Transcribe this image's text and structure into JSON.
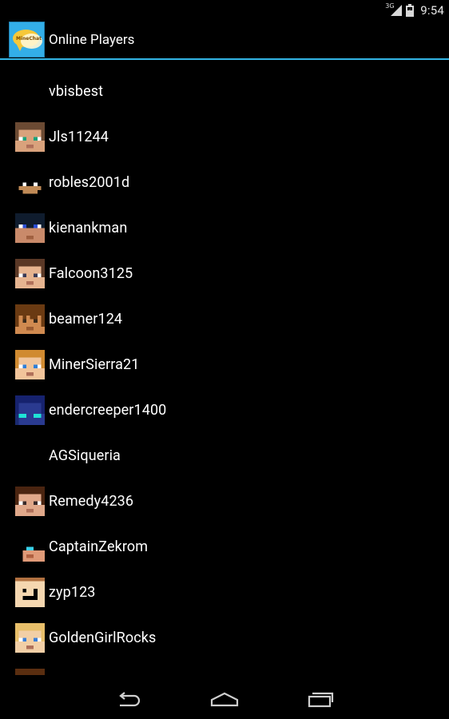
{
  "status_bar": {
    "network_type": "3G",
    "time": "9:54",
    "icons": [
      "signal-icon",
      "battery-icon"
    ]
  },
  "action_bar": {
    "app_icon": "minechat-app-icon",
    "app_icon_text": "MineChat",
    "title": "Online Players",
    "accent_color": "#33b5e5"
  },
  "players": [
    {
      "name": "vbisbest",
      "avatar": {
        "hair": null,
        "skin": null,
        "eyes": null,
        "style": "none"
      }
    },
    {
      "name": "Jls11244",
      "avatar": {
        "hair": "#6b4a33",
        "skin": "#d9a27c",
        "eyes": "#1aa37a",
        "style": "standard"
      }
    },
    {
      "name": "robles2001d",
      "avatar": {
        "hair": "#000000",
        "skin": "#c08a56",
        "eyes": "#ffffff",
        "style": "mask"
      }
    },
    {
      "name": "kienankman",
      "avatar": {
        "hair": "#0f1c2e",
        "skin": "#c98a6a",
        "eyes": "#2a4ed6",
        "style": "dark-top"
      }
    },
    {
      "name": "Falcoon3125",
      "avatar": {
        "hair": "#5a3826",
        "skin": "#e6b490",
        "eyes": "#3a3a55",
        "style": "standard"
      }
    },
    {
      "name": "beamer124",
      "avatar": {
        "hair": "#6a3a12",
        "skin": "#d08a50",
        "eyes": "#3a2a1a",
        "style": "fringe"
      }
    },
    {
      "name": "MinerSierra21",
      "avatar": {
        "hair": "#d08a30",
        "skin": "#f1c49a",
        "eyes": "#2f7fd8",
        "style": "standard"
      }
    },
    {
      "name": "endercreeper1400",
      "avatar": {
        "hair": "#16226e",
        "skin": "#2a3a90",
        "eyes": "#1fe3d6",
        "style": "ender"
      }
    },
    {
      "name": "AGSiqueria",
      "avatar": {
        "hair": null,
        "skin": null,
        "eyes": null,
        "style": "none"
      }
    },
    {
      "name": "Remedy4236",
      "avatar": {
        "hair": "#4a2410",
        "skin": "#e0a88a",
        "eyes": "#3a2a2a",
        "style": "standard"
      }
    },
    {
      "name": "CaptainZekrom",
      "avatar": {
        "hair": "#000000",
        "skin": "#e09a78",
        "eyes": "#3ad0e8",
        "style": "shadow"
      }
    },
    {
      "name": "zyp123",
      "avatar": {
        "hair": "#b07040",
        "skin": "#f5d7b0",
        "eyes": "#000000",
        "style": "face"
      }
    },
    {
      "name": "GoldenGirlRocks",
      "avatar": {
        "hair": "#e8bf6a",
        "skin": "#f2cfa6",
        "eyes": "#3a7fd8",
        "style": "standard"
      }
    },
    {
      "name": "",
      "avatar": {
        "hair": "#5a2e10",
        "skin": "#5a2e10",
        "eyes": "#5a2e10",
        "style": "partial"
      }
    }
  ],
  "nav_bar": {
    "buttons": [
      "back",
      "home",
      "recent-apps"
    ]
  }
}
